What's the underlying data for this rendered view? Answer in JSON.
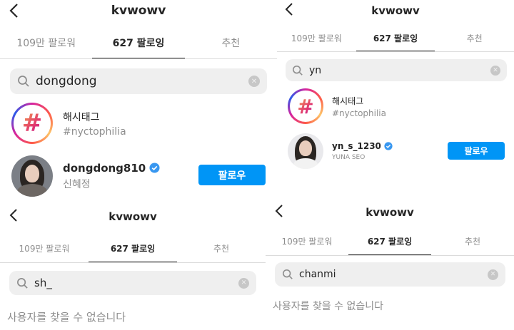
{
  "panels": [
    {
      "title": "kvwowv",
      "tabs": [
        "109만 팔로워",
        "627 팔로잉",
        "추천"
      ],
      "active_tab": 1,
      "search_value": "dongdong",
      "results": [
        {
          "type": "hashtag",
          "name": "해시태그",
          "sub": "#nyctophilia"
        },
        {
          "type": "user",
          "name": "dongdong810",
          "sub": "신혜정",
          "verified": true,
          "button": "팔로우"
        }
      ]
    },
    {
      "title": "kvwowv",
      "tabs": [
        "109만 팔로워",
        "627 팔로잉",
        "추천"
      ],
      "active_tab": 1,
      "search_value": "yn",
      "results": [
        {
          "type": "hashtag",
          "name": "해시태그",
          "sub": "#nyctophilia"
        },
        {
          "type": "user",
          "name": "yn_s_1230",
          "sub": "YUNA SEO",
          "verified": true,
          "button": "팔로우"
        }
      ]
    },
    {
      "title": "kvwowv",
      "tabs": [
        "109만 팔로워",
        "627 팔로잉",
        "추천"
      ],
      "active_tab": 1,
      "search_value": "sh_",
      "empty_text": "사용자를 찾을 수 없습니다"
    },
    {
      "title": "kvwowv",
      "tabs": [
        "109만 팔로워",
        "627 팔로잉",
        "추천"
      ],
      "active_tab": 1,
      "search_value": "chanmi",
      "empty_text": "사용자를 찾을 수 없습니다"
    }
  ],
  "icons": {
    "back": "chevron-left-icon",
    "search": "search-icon",
    "clear": "clear-icon",
    "verified": "verified-badge-icon",
    "hashtag": "hashtag-icon"
  },
  "colors": {
    "accent": "#0095f6",
    "muted": "#8e8e8e",
    "search_bg": "#efefef"
  }
}
